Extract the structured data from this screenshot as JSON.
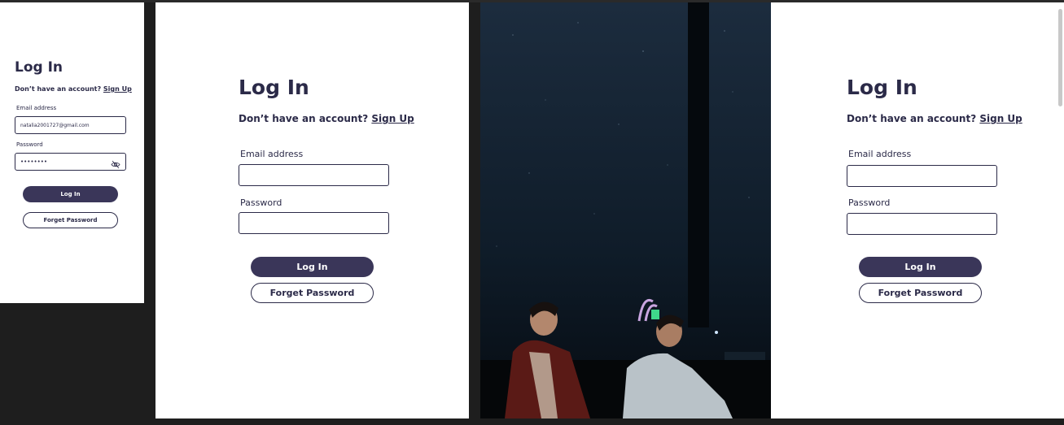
{
  "frames": {
    "small": {
      "title": "Log In",
      "no_account_text": "Don’t have an account?",
      "signup_link": "Sign Up",
      "email_label": "Email address",
      "email_value": "natalia2001727@gmail.com",
      "password_label": "Password",
      "password_value": "••••••••",
      "login_button": "Log In",
      "forget_button": "Forget Password"
    },
    "medium": {
      "title": "Log In",
      "no_account_text": "Don’t have an account?",
      "signup_link": "Sign Up",
      "email_label": "Email address",
      "password_label": "Password",
      "login_button": "Log In",
      "forget_button": "Forget Password"
    },
    "large": {
      "title": "Log In",
      "no_account_text": "Don’t have an account?",
      "signup_link": "Sign Up",
      "email_label": "Email address",
      "password_label": "Password",
      "login_button": "Log In",
      "forget_button": "Forget Password"
    }
  },
  "icons": {
    "password_toggle": "eye-off-icon"
  },
  "colors": {
    "canvas": "#1e1e1e",
    "primary": "#3a3659",
    "text": "#2b2a48",
    "card": "#ffffff"
  }
}
